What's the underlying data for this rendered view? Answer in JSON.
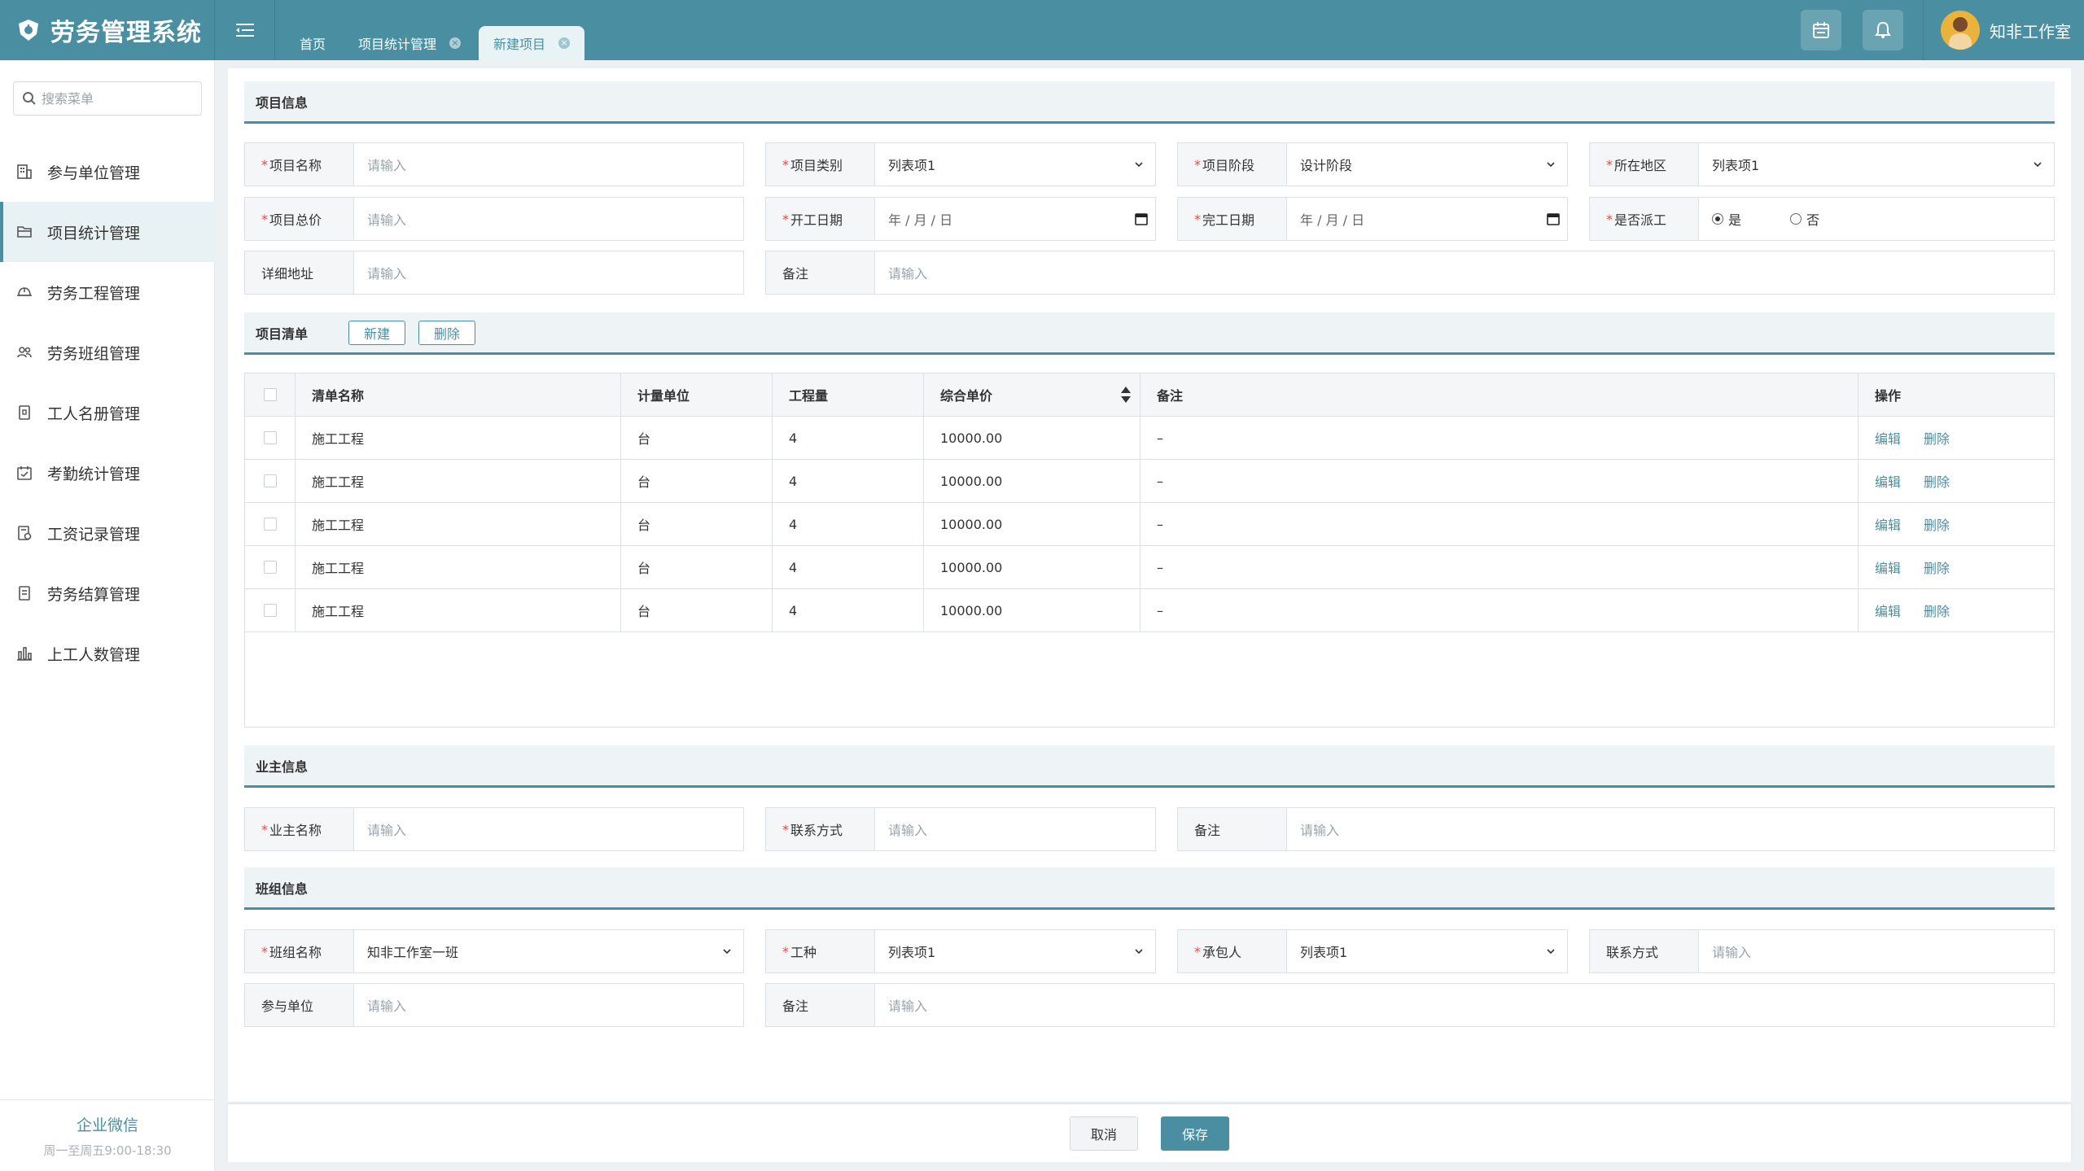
{
  "app": {
    "title": "劳务管理系统"
  },
  "tabs": [
    {
      "label": "首页"
    },
    {
      "label": "项目统计管理"
    },
    {
      "label": "新建项目"
    }
  ],
  "user": {
    "name": "知非工作室"
  },
  "sidebar": {
    "search_placeholder": "搜索菜单",
    "items": [
      {
        "label": "参与单位管理",
        "icon": "building-icon"
      },
      {
        "label": "项目统计管理",
        "icon": "folder-icon"
      },
      {
        "label": "劳务工程管理",
        "icon": "helmet-icon"
      },
      {
        "label": "劳务班组管理",
        "icon": "team-icon"
      },
      {
        "label": "工人名册管理",
        "icon": "roster-icon"
      },
      {
        "label": "考勤统计管理",
        "icon": "calendar-icon"
      },
      {
        "label": "工资记录管理",
        "icon": "salary-icon"
      },
      {
        "label": "劳务结算管理",
        "icon": "document-icon"
      },
      {
        "label": "上工人数管理",
        "icon": "bar-chart-icon"
      }
    ],
    "footer": {
      "link": "企业微信",
      "hours": "周一至周五9:00-18:30"
    }
  },
  "project_info": {
    "title": "项目信息",
    "name": {
      "label": "项目名称",
      "placeholder": "请输入"
    },
    "category": {
      "label": "项目类别",
      "value": "列表项1"
    },
    "stage": {
      "label": "项目阶段",
      "value": "设计阶段"
    },
    "region": {
      "label": "所在地区",
      "value": "列表项1"
    },
    "total": {
      "label": "项目总价",
      "placeholder": "请输入"
    },
    "start_date": {
      "label": "开工日期",
      "placeholder": "年 / 月 / 日"
    },
    "end_date": {
      "label": "完工日期",
      "placeholder": "年 / 月 / 日"
    },
    "dispatch": {
      "label": "是否派工",
      "yes": "是",
      "no": "否",
      "selected": "是"
    },
    "address": {
      "label": "详细地址",
      "placeholder": "请输入"
    },
    "note": {
      "label": "备注",
      "placeholder": "请输入"
    }
  },
  "bill": {
    "title": "项目清单",
    "new_label": "新建",
    "delete_label": "删除",
    "columns": [
      "清单名称",
      "计量单位",
      "工程量",
      "综合单价",
      "备注",
      "操作"
    ],
    "rows": [
      {
        "name": "施工工程",
        "unit": "台",
        "qty": "4",
        "price": "10000.00",
        "note": "–",
        "edit": "编辑",
        "del": "删除"
      },
      {
        "name": "施工工程",
        "unit": "台",
        "qty": "4",
        "price": "10000.00",
        "note": "–",
        "edit": "编辑",
        "del": "删除"
      },
      {
        "name": "施工工程",
        "unit": "台",
        "qty": "4",
        "price": "10000.00",
        "note": "–",
        "edit": "编辑",
        "del": "删除"
      },
      {
        "name": "施工工程",
        "unit": "台",
        "qty": "4",
        "price": "10000.00",
        "note": "–",
        "edit": "编辑",
        "del": "删除"
      },
      {
        "name": "施工工程",
        "unit": "台",
        "qty": "4",
        "price": "10000.00",
        "note": "–",
        "edit": "编辑",
        "del": "删除"
      }
    ]
  },
  "owner_info": {
    "title": "业主信息",
    "name": {
      "label": "业主名称",
      "placeholder": "请输入"
    },
    "contact": {
      "label": "联系方式",
      "placeholder": "请输入"
    },
    "note": {
      "label": "备注",
      "placeholder": "请输入"
    }
  },
  "team_info": {
    "title": "班组信息",
    "team_name": {
      "label": "班组名称",
      "value": "知非工作室一班"
    },
    "trade": {
      "label": "工种",
      "value": "列表项1"
    },
    "contractor": {
      "label": "承包人",
      "value": "列表项1"
    },
    "contact": {
      "label": "联系方式",
      "placeholder": "请输入"
    },
    "unit": {
      "label": "参与单位",
      "placeholder": "请输入"
    },
    "note": {
      "label": "备注",
      "placeholder": "请输入"
    }
  },
  "actions": {
    "cancel": "取消",
    "save": "保存"
  },
  "colors": {
    "brand": "#4a8fa1",
    "required": "#e5484d"
  }
}
